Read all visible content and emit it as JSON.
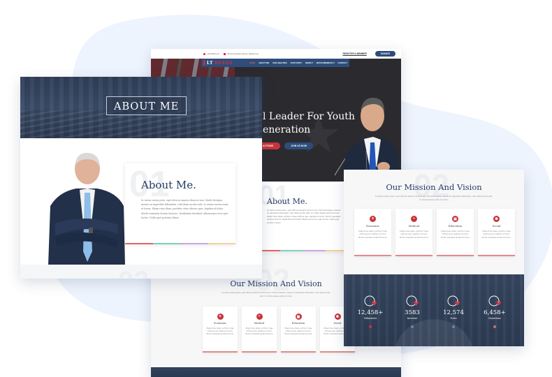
{
  "colors": {
    "brand_navy": "#2e4d7b",
    "accent_red": "#c9343c",
    "heading": "#243b63",
    "rainbow": [
      "#e06666",
      "#7fd1b9",
      "#c7a6e8",
      "#f5d199"
    ]
  },
  "home_page": {
    "topbar": {
      "phone": "+1(234)5xxxx",
      "address": "44 New Design Street, Melbourne",
      "register_label": "REGISTER A MEMBER",
      "donate_label": "DONATE"
    },
    "navbar": {
      "logo_prefix": "LT",
      "logo_accent": "RESAN",
      "items": [
        {
          "label": "HOME",
          "active": true
        },
        {
          "label": "ABOUT ME",
          "active": false
        },
        {
          "label": "OUR ABILITIES",
          "active": false
        },
        {
          "label": "OUR STORY",
          "active": false
        },
        {
          "label": "NEWS ▾",
          "active": false
        },
        {
          "label": "WOOCOMMERCE ▾",
          "active": false
        },
        {
          "label": "CONTACT",
          "active": false
        }
      ]
    },
    "hero": {
      "title_line1": "l Leader For Youth",
      "title_line2": "eneration",
      "btn_primary": "ACTIONS",
      "btn_secondary": "JOIN US NOW"
    },
    "about": {
      "number": "01",
      "title": "About Me.",
      "text": "In varius varius justo, eget ultrices mauris rhoncus non. Morbi tristique, mauris eu imperdiet bibendum, velit diam iaculis velit, in ornare massa enim at lorem. Etiam risus diam, porttitor vitae ultrices quis, dapibus id dolor. Morbi venenatis lacinia rhoncus. Vestibulum tincidunt ullamcorper eros eget luctus. Nulla eget porttitor libero."
    },
    "mission": {
      "number": "02",
      "title": "Our Mission And Vision",
      "subtitle": "In varius varius justo, eget ultrices mauris rhoncus non. Morbi tristique, mauris eu imperdiet bibendum, velit diam iaculis velit, in ornare massa enim at lorem."
    }
  },
  "about_page": {
    "banner_title": "ABOUT ME",
    "number": "01",
    "title": "About Me.",
    "text": "In varius varius justo, eget ultrices mauris rhoncus non. Morbi tristique, mauris eu imperdiet bibendum, velit diam iaculis velit, in ornare massa enim at lorem. Etiam risus diam, porttitor vitae ultrices quis, dapibus id dolor. Morbi venenatis lacinia rhoncus. Vestibulum tincidunt ullamcorper eros eget luctus. Nulla eget porttitor libero.",
    "next_number": "02"
  },
  "mission_cards": [
    {
      "name": "Economic",
      "icon": "coin-icon",
      "glyph": "$",
      "text": "Etiam risus diam, porttitor vitae ultrices quis, dapibus id dolor. Morbi venenatis lacinia rhoncus."
    },
    {
      "name": "Medical",
      "icon": "medical-pin-icon",
      "glyph": "+",
      "text": "Etiam risus diam, porttitor vitae ultrices quis, dapibus id dolor. Morbi venenatis lacinia rhoncus."
    },
    {
      "name": "Education",
      "icon": "education-icon",
      "glyph": "▣",
      "text": "Etiam risus diam, porttitor vitae ultrices quis, dapibus id dolor. Morbi venenatis lacinia rhoncus."
    },
    {
      "name": "Social",
      "icon": "social-globe-icon",
      "glyph": "✺",
      "text": "Etiam risus diam, porttitor vitae ultrices quis, dapibus id dolor. Morbi venenatis lacinia rhoncus."
    }
  ],
  "mission_page": {
    "number": "02",
    "title": "Our Mission And Vision",
    "subtitle": "In varius varius justo, eget ultrices mauris rhoncus non. Morbi tristique, mauris eu imperdiet bibendum, velit diam iaculis velit, in ornare massa enim at lorem.",
    "stats": [
      {
        "value": "12,458+",
        "label": "Volunteers",
        "icon": "globe-hands-icon",
        "dot": "#c9343c"
      },
      {
        "value": "3583",
        "label": "Increase",
        "icon": "heart-hands-icon",
        "dot": "#6b84a8"
      },
      {
        "value": "12,574",
        "label": "Votes",
        "icon": "house-heart-icon",
        "dot": "#6b84a8"
      },
      {
        "value": "6,458+",
        "label": "Donations",
        "icon": "donation-box-icon",
        "dot": "#c9736a"
      }
    ]
  }
}
